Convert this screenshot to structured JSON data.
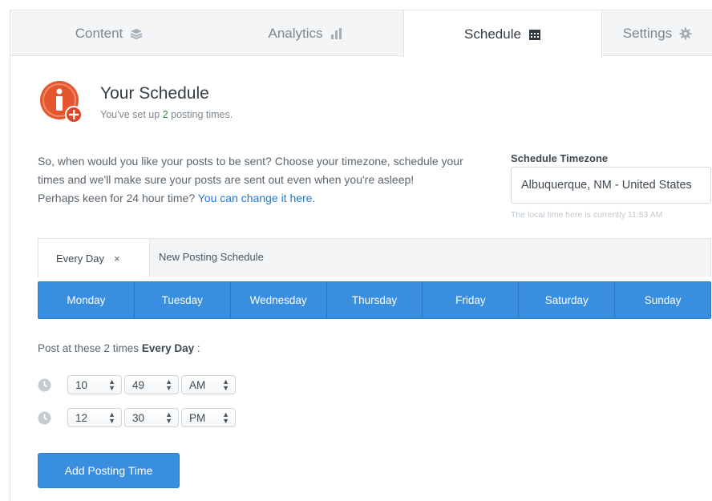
{
  "tabs": [
    {
      "label": "Content",
      "icon": "layers-icon",
      "active": false
    },
    {
      "label": "Analytics",
      "icon": "bar-chart-icon",
      "active": false
    },
    {
      "label": "Schedule",
      "icon": "calendar-icon",
      "active": true
    },
    {
      "label": "Settings",
      "icon": "gear-icon",
      "active": false
    }
  ],
  "header": {
    "title": "Your Schedule",
    "subtitle_prefix": "You've set up ",
    "subtitle_count": "2",
    "subtitle_suffix": " posting times.",
    "icon": "info-add-icon"
  },
  "description": {
    "line1": "So, when would you like your posts to be sent? Choose your timezone, schedule your times and we'll make sure your posts are sent out even when you're asleep!",
    "line2_prefix": "Perhaps keen for 24 hour time? ",
    "line2_link": "You can change it here."
  },
  "timezone": {
    "label": "Schedule Timezone",
    "value": "Albuquerque, NM - United States",
    "note": "The local time here is currently 11:53 AM"
  },
  "schedule_tabs": {
    "active_label": "Every Day",
    "close_symbol": "×",
    "new_label": "New Posting Schedule"
  },
  "days": [
    "Monday",
    "Tuesday",
    "Wednesday",
    "Thursday",
    "Friday",
    "Saturday",
    "Sunday"
  ],
  "post_label": {
    "prefix": "Post at these 2 times ",
    "bold": "Every Day",
    "suffix": " :"
  },
  "times": [
    {
      "hour": "10",
      "minute": "49",
      "ampm": "AM"
    },
    {
      "hour": "12",
      "minute": "30",
      "ampm": "PM"
    }
  ],
  "add_button": "Add Posting Time",
  "colors": {
    "accent": "#3a8ee0",
    "brand_orange": "#e4572e",
    "link": "#1f7ad1",
    "count_green": "#2e8b3a"
  }
}
